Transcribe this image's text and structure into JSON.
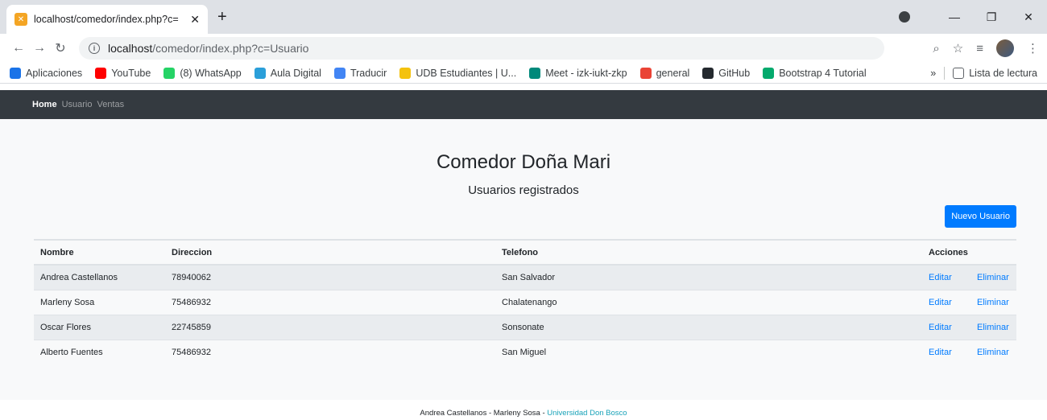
{
  "browser": {
    "tab_title": "localhost/comedor/index.php?c=",
    "url_host": "localhost",
    "url_path": "/comedor/index.php?c=Usuario",
    "bookmarks": [
      {
        "label": "Aplicaciones",
        "icon": "apps-grid-icon",
        "color": "#1a73e8"
      },
      {
        "label": "YouTube",
        "icon": "youtube-icon",
        "color": "#ff0000"
      },
      {
        "label": "(8) WhatsApp",
        "icon": "whatsapp-icon",
        "color": "#25d366"
      },
      {
        "label": "Aula Digital",
        "icon": "aula-digital-icon",
        "color": "#2b9fd9"
      },
      {
        "label": "Traducir",
        "icon": "translate-icon",
        "color": "#4285f4"
      },
      {
        "label": "UDB Estudiantes | U...",
        "icon": "udb-icon",
        "color": "#f4c20d"
      },
      {
        "label": "Meet - izk-iukt-zkp",
        "icon": "meet-icon",
        "color": "#00897b"
      },
      {
        "label": "general",
        "icon": "general-icon",
        "color": "#ea4335"
      },
      {
        "label": "GitHub",
        "icon": "github-icon",
        "color": "#24292e"
      },
      {
        "label": "Bootstrap 4 Tutorial",
        "icon": "w3schools-icon",
        "color": "#04aa6d"
      }
    ],
    "more_label": "»",
    "reading_list": "Lista de lectura"
  },
  "nav": {
    "brand": "Home",
    "links": [
      "Usuario",
      "Ventas"
    ]
  },
  "page": {
    "title": "Comedor Doña Mari",
    "subtitle": "Usuarios registrados",
    "new_button": "Nuevo Usuario"
  },
  "table": {
    "headers": [
      "Nombre",
      "Direccion",
      "Telefono",
      "Acciones"
    ],
    "rows": [
      {
        "nombre": "Andrea Castellanos",
        "direccion": "78940062",
        "telefono": "San Salvador",
        "edit": "Editar",
        "delete": "Eliminar"
      },
      {
        "nombre": "Marleny Sosa",
        "direccion": "75486932",
        "telefono": "Chalatenango",
        "edit": "Editar",
        "delete": "Eliminar"
      },
      {
        "nombre": "Oscar Flores",
        "direccion": "22745859",
        "telefono": "Sonsonate",
        "edit": "Editar",
        "delete": "Eliminar"
      },
      {
        "nombre": "Alberto Fuentes",
        "direccion": "75486932",
        "telefono": "San Miguel",
        "edit": "Editar",
        "delete": "Eliminar"
      }
    ]
  },
  "footer": {
    "authors": "Andrea Castellanos - Marleny Sosa - ",
    "university": "Universidad Don Bosco"
  },
  "colors": {
    "navbar": "#343a40",
    "primary": "#007bff",
    "footer_link": "#17a2b8"
  }
}
